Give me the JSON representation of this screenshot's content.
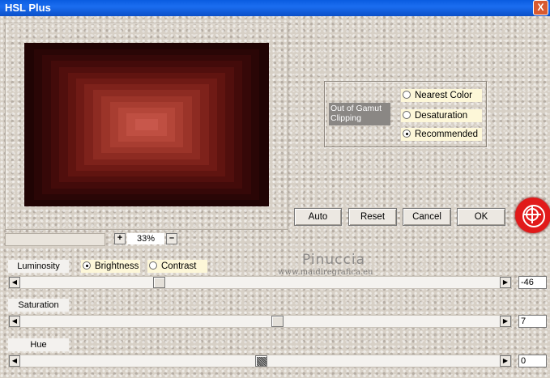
{
  "window": {
    "title": "HSL Plus",
    "close_label": "X"
  },
  "gamut": {
    "label": "Out of Gamut Clipping",
    "options": [
      {
        "label": "Nearest Color",
        "selected": false
      },
      {
        "label": "Desaturation",
        "selected": false
      },
      {
        "label": "Recommended",
        "selected": true
      }
    ]
  },
  "buttons": {
    "auto": "Auto",
    "reset": "Reset",
    "cancel": "Cancel",
    "ok": "OK"
  },
  "zoom": {
    "plus": "+",
    "minus": "–",
    "value": "33%"
  },
  "mode": {
    "label": "Luminosity",
    "options": [
      {
        "label": "Brightness",
        "selected": true
      },
      {
        "label": "Contrast",
        "selected": false
      }
    ]
  },
  "sliders": {
    "luminosity": {
      "value": "-46",
      "level": 0.283
    },
    "saturation": {
      "label": "Saturation",
      "value": "7",
      "level": 0.535
    },
    "hue": {
      "label": "Hue",
      "value": "0",
      "level": 0.5
    }
  },
  "watermark": {
    "name": "Pinuccia",
    "url": "www.maidiregrafica.eu"
  },
  "colors": {
    "title_bar": "#0a5ce0",
    "preview_dark": "#200404",
    "preview_center": "#c8504a",
    "logo_red": "#e11a1a"
  }
}
